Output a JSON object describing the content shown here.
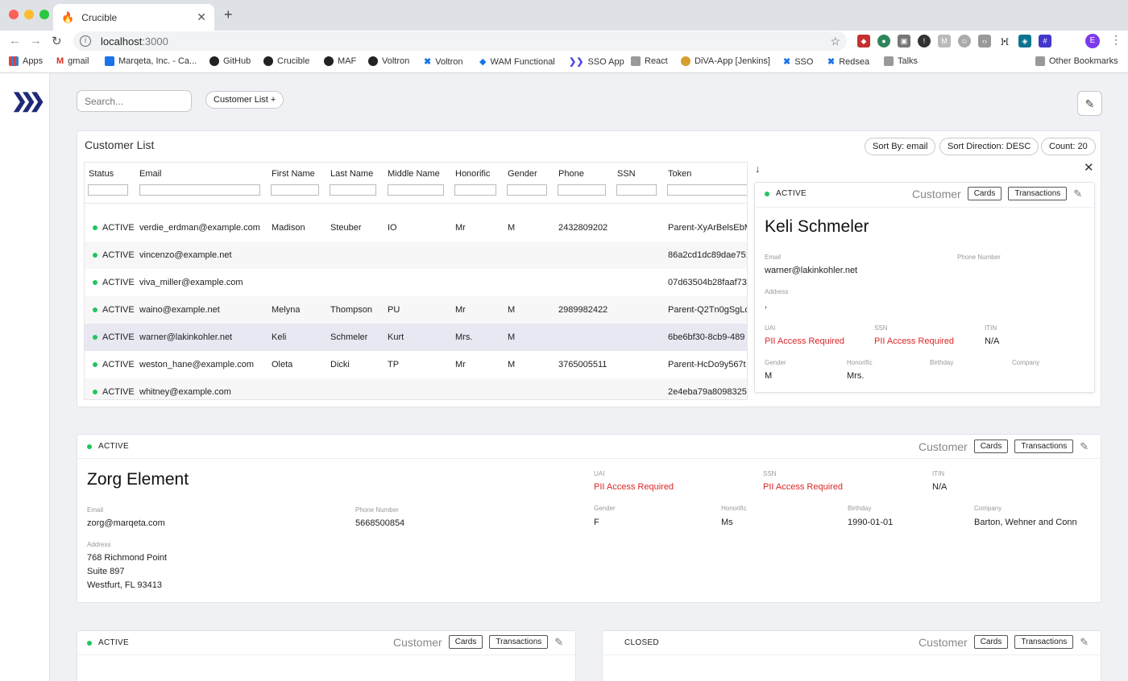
{
  "browser": {
    "tab_title": "Crucible",
    "url_host": "localhost",
    "url_port": ":3000",
    "bookmarks": [
      "Apps",
      "gmail",
      "Marqeta, Inc. - Ca...",
      "GitHub",
      "Crucible",
      "MAF",
      "Voltron",
      "Voltron",
      "WAM Functional",
      "SSO App",
      "React",
      "DiVA-App [Jenkins]",
      "SSO",
      "Redsea",
      "Talks",
      "Other Bookmarks"
    ],
    "profile_initial": "E"
  },
  "toolbar": {
    "search_placeholder": "Search...",
    "customer_list_button": "Customer List +"
  },
  "customer_list": {
    "title": "Customer List",
    "sort_by": "Sort By: email",
    "sort_direction": "Sort Direction: DESC",
    "count": "Count: 20",
    "columns": [
      "Status",
      "Email",
      "First Name",
      "Last Name",
      "Middle Name",
      "Honorific",
      "Gender",
      "Phone",
      "SSN",
      "Token"
    ],
    "rows": [
      {
        "status": "ACTIVE",
        "email": "verdie_erdman@example.com",
        "first": "Madison",
        "last": "Steuber",
        "middle": "IO",
        "honorific": "Mr",
        "gender": "M",
        "phone": "2432809202",
        "ssn": "",
        "token": "Parent-XyArBelsEbM"
      },
      {
        "status": "ACTIVE",
        "email": "vincenzo@example.net",
        "first": "",
        "last": "",
        "middle": "",
        "honorific": "",
        "gender": "",
        "phone": "",
        "ssn": "",
        "token": "86a2cd1dc89dae751"
      },
      {
        "status": "ACTIVE",
        "email": "viva_miller@example.com",
        "first": "",
        "last": "",
        "middle": "",
        "honorific": "",
        "gender": "",
        "phone": "",
        "ssn": "",
        "token": "07d63504b28faaf73"
      },
      {
        "status": "ACTIVE",
        "email": "waino@example.net",
        "first": "Melyna",
        "last": "Thompson",
        "middle": "PU",
        "honorific": "Mr",
        "gender": "M",
        "phone": "2989982422",
        "ssn": "",
        "token": "Parent-Q2Tn0gSgLd"
      },
      {
        "status": "ACTIVE",
        "email": "warner@lakinkohler.net",
        "first": "Keli",
        "last": "Schmeler",
        "middle": "Kurt",
        "honorific": "Mrs.",
        "gender": "M",
        "phone": "",
        "ssn": "",
        "token": "6be6bf30-8cb9-489"
      },
      {
        "status": "ACTIVE",
        "email": "weston_hane@example.com",
        "first": "Oleta",
        "last": "Dicki",
        "middle": "TP",
        "honorific": "Mr",
        "gender": "M",
        "phone": "3765005511",
        "ssn": "",
        "token": "Parent-HcDo9y567t"
      },
      {
        "status": "ACTIVE",
        "email": "whitney@example.com",
        "first": "",
        "last": "",
        "middle": "",
        "honorific": "",
        "gender": "",
        "phone": "",
        "ssn": "",
        "token": "2e4eba79a8098325"
      }
    ]
  },
  "detail": {
    "status": "ACTIVE",
    "type": "Customer",
    "cards": "Cards",
    "transactions": "Transactions",
    "name": "Keli Schmeler",
    "email_label": "Email",
    "email": "warner@lakinkohler.net",
    "phone_label": "Phone Number",
    "address_label": "Address",
    "address": ",",
    "uai_label": "UAI",
    "uai": "PII Access Required",
    "ssn_label": "SSN",
    "ssn": "PII Access Required",
    "itin_label": "ITIN",
    "itin": "N/A",
    "gender_label": "Gender",
    "gender": "M",
    "honorific_label": "Honorific",
    "honorific": "Mrs.",
    "birthday_label": "Birthday",
    "company_label": "Company"
  },
  "zorg": {
    "status": "ACTIVE",
    "type": "Customer",
    "cards": "Cards",
    "transactions": "Transactions",
    "name": "Zorg Element",
    "email_label": "Email",
    "email": "zorg@marqeta.com",
    "phone_label": "Phone Number",
    "phone": "5668500854",
    "address_label": "Address",
    "address1": "768 Richmond Point",
    "address2": "Suite 897",
    "address3": "Westfurt, FL 93413",
    "uai_label": "UAI",
    "uai": "PII Access Required",
    "ssn_label": "SSN",
    "ssn": "PII Access Required",
    "itin_label": "ITIN",
    "itin": "N/A",
    "gender_label": "Gender",
    "gender": "F",
    "honorific_label": "Honorific",
    "honorific": "Ms",
    "birthday_label": "Birthday",
    "birthday": "1990-01-01",
    "company_label": "Company",
    "company": "Barton, Wehner and Conn"
  },
  "bottom_left": {
    "status": "ACTIVE",
    "type": "Customer",
    "cards": "Cards",
    "transactions": "Transactions"
  },
  "bottom_right": {
    "status": "CLOSED",
    "type": "Customer",
    "cards": "Cards",
    "transactions": "Transactions"
  },
  "colors": {
    "active": "#22c55e",
    "pii": "#dc2626",
    "brand": "#1e2a78"
  }
}
